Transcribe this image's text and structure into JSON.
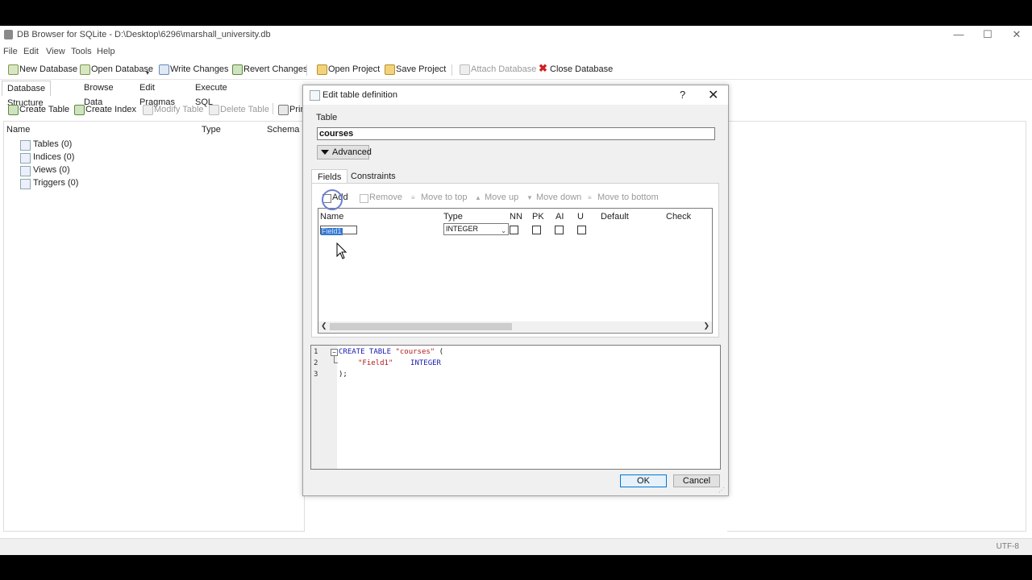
{
  "window": {
    "title": "DB Browser for SQLite - D:\\Desktop\\6296\\marshall_university.db"
  },
  "menu": [
    "File",
    "Edit",
    "View",
    "Tools",
    "Help"
  ],
  "toolbar": {
    "new_database": "New Database",
    "open_database": "Open Database",
    "write_changes": "Write Changes",
    "revert_changes": "Revert Changes",
    "open_project": "Open Project",
    "save_project": "Save Project",
    "attach_database": "Attach Database",
    "close_database": "Close Database"
  },
  "main_tabs": [
    "Database Structure",
    "Browse Data",
    "Edit Pragmas",
    "Execute SQL"
  ],
  "structure_toolbar": {
    "create_table": "Create Table",
    "create_index": "Create Index",
    "modify_table": "Modify Table",
    "delete_table": "Delete Table",
    "print": "Prin"
  },
  "tree": {
    "headers": [
      "Name",
      "Type",
      "Schema"
    ],
    "items": [
      "Tables (0)",
      "Indices (0)",
      "Views (0)",
      "Triggers (0)"
    ]
  },
  "status": {
    "encoding": "UTF-8"
  },
  "dialog": {
    "title": "Edit table definition",
    "help": "?",
    "table_label": "Table",
    "table_name": "courses",
    "advanced": "Advanced",
    "tabs": [
      "Fields",
      "Constraints"
    ],
    "field_tools": {
      "add": "Add",
      "remove": "Remove",
      "move_top": "Move to top",
      "move_up": "Move up",
      "move_down": "Move down",
      "move_bottom": "Move to bottom"
    },
    "columns": [
      "Name",
      "Type",
      "NN",
      "PK",
      "AI",
      "U",
      "Default",
      "Check"
    ],
    "field": {
      "name": "Field1",
      "type": "INTEGER"
    },
    "sql": {
      "line_numbers": [
        "1",
        "2",
        "3"
      ],
      "l1_kw": "CREATE TABLE",
      "l1_str": "\"courses\"",
      "l1_end": "(",
      "l2_str": "\"Field1\"",
      "l2_kw": "INTEGER",
      "l3": ");"
    },
    "ok": "OK",
    "cancel": "Cancel"
  }
}
